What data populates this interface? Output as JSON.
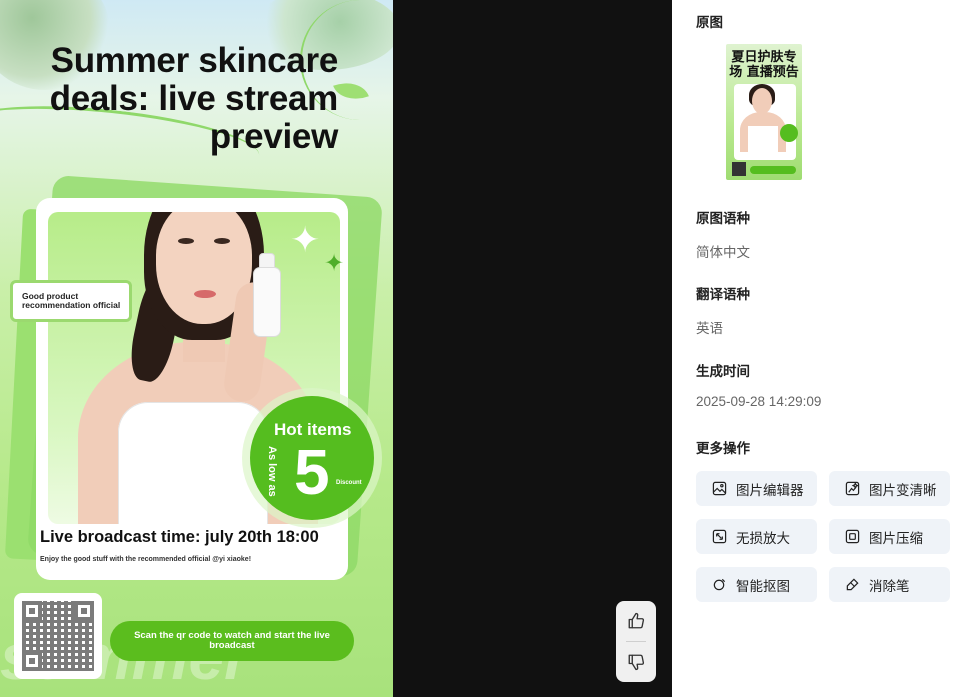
{
  "poster": {
    "title": "Summer skincare deals: live stream preview",
    "reco_tag": "Good product recommendation official",
    "hot_title": "Hot items",
    "hot_as_low": "As low as",
    "hot_number": "5",
    "hot_discount": "Discount",
    "live_time": "Live broadcast time: july 20th 18:00",
    "live_sub": "Enjoy the good stuff with the recommended official @yi xiaoke!",
    "scan_text": "Scan the qr code to watch and start the live broadcast",
    "bg_word": "summer"
  },
  "thumbnail": {
    "title": "夏日护肤专场 直播预告"
  },
  "panel": {
    "original_label": "原图",
    "src_lang_label": "原图语种",
    "src_lang_value": "简体中文",
    "tgt_lang_label": "翻译语种",
    "tgt_lang_value": "英语",
    "time_label": "生成时间",
    "time_value": "2025-09-28 14:29:09",
    "more_label": "更多操作",
    "actions": [
      {
        "label": "图片编辑器",
        "icon": "image-edit-icon"
      },
      {
        "label": "图片变清晰",
        "icon": "image-enhance-icon"
      },
      {
        "label": "无损放大",
        "icon": "upscale-icon"
      },
      {
        "label": "图片压缩",
        "icon": "compress-icon"
      },
      {
        "label": "智能抠图",
        "icon": "cutout-icon"
      },
      {
        "label": "消除笔",
        "icon": "eraser-icon"
      }
    ]
  },
  "feedback": {
    "like_icon": "thumbs-up-icon",
    "dislike_icon": "thumbs-down-icon"
  },
  "colors": {
    "accent_green": "#55bd1f",
    "canvas_bg": "#111111",
    "action_bg": "#eff3f8"
  }
}
